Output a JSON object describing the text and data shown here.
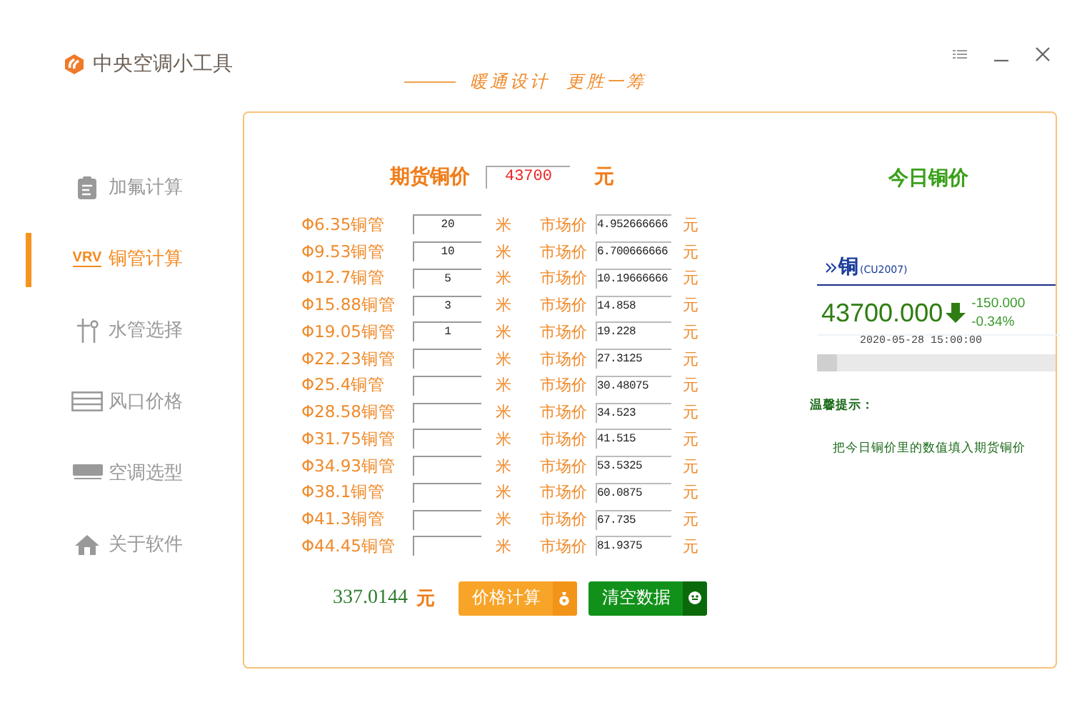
{
  "window": {
    "title": "中央空调小工具",
    "slogan": "暖通设计  更胜一筹"
  },
  "sidebar": {
    "items": [
      {
        "label": "加氟计算",
        "kind": "clipboard",
        "selected": false
      },
      {
        "label": "铜管计算",
        "kind": "badge",
        "badge": "VRV",
        "selected": true
      },
      {
        "label": "水管选择",
        "kind": "pipes",
        "selected": false
      },
      {
        "label": "风口价格",
        "kind": "vent",
        "selected": false
      },
      {
        "label": "空调选型",
        "kind": "aircon",
        "selected": false
      },
      {
        "label": "关于软件",
        "kind": "home",
        "selected": false
      }
    ]
  },
  "futures": {
    "label": "期货铜价",
    "value": "43700",
    "unit": "元"
  },
  "pipes": [
    {
      "name": "Φ6.35铜管",
      "length": "20",
      "unit": "米",
      "price_label": "市场价",
      "price": "4.952666666",
      "currency": "元"
    },
    {
      "name": "Φ9.53铜管",
      "length": "10",
      "unit": "米",
      "price_label": "市场价",
      "price": "6.700666666",
      "currency": "元"
    },
    {
      "name": "Φ12.7铜管",
      "length": "5",
      "unit": "米",
      "price_label": "市场价",
      "price": "10.19666666",
      "currency": "元"
    },
    {
      "name": "Φ15.88铜管",
      "length": "3",
      "unit": "米",
      "price_label": "市场价",
      "price": "14.858",
      "currency": "元"
    },
    {
      "name": "Φ19.05铜管",
      "length": "1",
      "unit": "米",
      "price_label": "市场价",
      "price": "19.228",
      "currency": "元"
    },
    {
      "name": "Φ22.23铜管",
      "unit": "米",
      "price_label": "市场价",
      "price": "27.3125",
      "currency": "元"
    },
    {
      "name": "Φ25.4铜管",
      "unit": "米",
      "price_label": "市场价",
      "price": "30.48075",
      "currency": "元"
    },
    {
      "name": "Φ28.58铜管",
      "unit": "米",
      "price_label": "市场价",
      "price": "34.523",
      "currency": "元"
    },
    {
      "name": "Φ31.75铜管",
      "unit": "米",
      "price_label": "市场价",
      "price": "41.515",
      "currency": "元"
    },
    {
      "name": "Φ34.93铜管",
      "unit": "米",
      "price_label": "市场价",
      "price": "53.5325",
      "currency": "元"
    },
    {
      "name": "Φ38.1铜管",
      "unit": "米",
      "price_label": "市场价",
      "price": "60.0875",
      "currency": "元"
    },
    {
      "name": "Φ41.3铜管",
      "unit": "米",
      "price_label": "市场价",
      "price": "67.735",
      "currency": "元"
    },
    {
      "name": "Φ44.45铜管",
      "unit": "米",
      "price_label": "市场价",
      "price": "81.9375",
      "currency": "元"
    }
  ],
  "total": {
    "value": "337.0144",
    "unit": "元"
  },
  "buttons": [
    {
      "label": "价格计算",
      "kind": "calculate"
    },
    {
      "label": "清空数据",
      "kind": "clear"
    }
  ],
  "today": {
    "title": "今日铜价",
    "name": "铜",
    "code": "(CU2007)",
    "price": "43700.000",
    "change": "-150.000",
    "percent": "-0.34%",
    "time": "2020-05-28 15:00:00",
    "tip_title": "温馨提示：",
    "tip": "把今日铜价里的数值填入期货铜价"
  }
}
